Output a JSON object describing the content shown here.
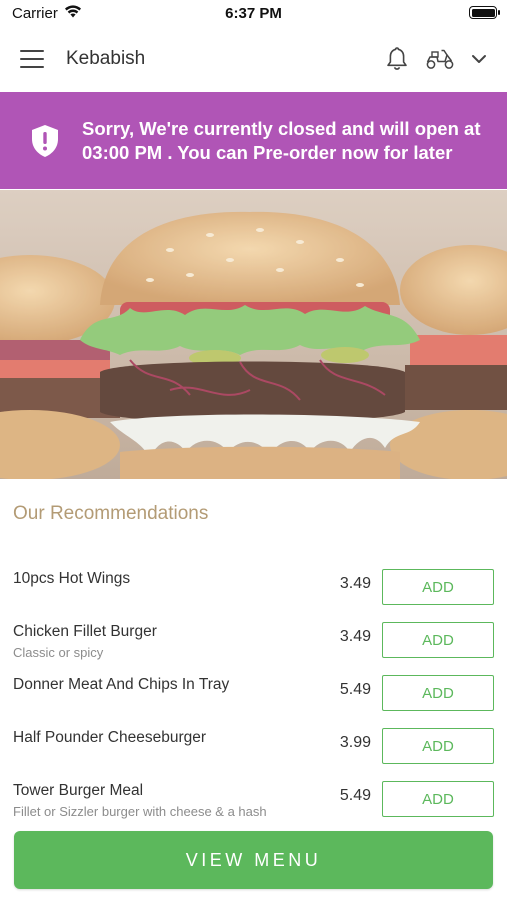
{
  "status_bar": {
    "carrier": "Carrier",
    "time": "6:37 PM"
  },
  "header": {
    "title": "Kebabish",
    "icons": [
      "menu-icon",
      "bell-icon",
      "scooter-icon",
      "chevron-down-icon"
    ]
  },
  "banner": {
    "text": "Sorry, We're currently closed and will open at 03:00 PM . You can Pre-order now for later",
    "background": "#b055b6",
    "icon": "shield-alert-icon"
  },
  "recommendations": {
    "title": "Our Recommendations",
    "items": [
      {
        "name": "10pcs Hot Wings",
        "description": "",
        "price": "3.49",
        "button": "ADD"
      },
      {
        "name": "Chicken Fillet Burger",
        "description": "Classic or spicy",
        "price": "3.49",
        "button": "ADD"
      },
      {
        "name": "Donner Meat And Chips In Tray",
        "description": "",
        "price": "5.49",
        "button": "ADD"
      },
      {
        "name": "Half Pounder Cheeseburger",
        "description": "",
        "price": "3.99",
        "button": "ADD"
      },
      {
        "name": "Tower Burger Meal",
        "description": "Fillet or Sizzler burger with cheese & a hash",
        "price": "5.49",
        "button": "ADD"
      }
    ]
  },
  "view_menu": {
    "label": "VIEW MENU"
  },
  "colors": {
    "accent_green": "#5cb85c",
    "banner_purple": "#b055b6",
    "recommendation_title": "#b39b75"
  }
}
